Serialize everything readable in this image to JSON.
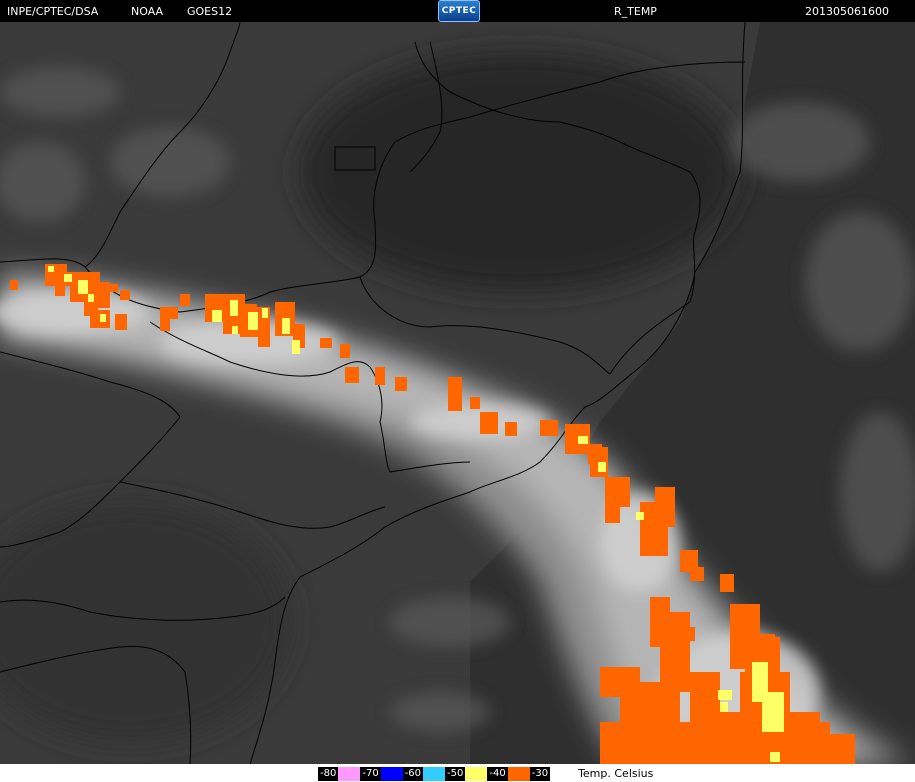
{
  "header": {
    "source": "INPE/CPTEC/DSA",
    "agency": "NOAA",
    "satellite": "GOES12",
    "logo_text": "CPTEC",
    "product": "R_TEMP",
    "timestamp": "201305061600"
  },
  "colors": {
    "background": "#000000",
    "cloud_base": "#c8c8c8",
    "land_dark": "#3a3a3a",
    "ocean_dark": "#2c2c2c",
    "border_lines": "#000000",
    "band_minus30": "#ff6600",
    "band_minus40": "#ffff66"
  },
  "legend": {
    "caption": "Temp. Celsius",
    "items": [
      {
        "label": "-80",
        "color": "#ff99ff"
      },
      {
        "label": "-70",
        "color": "#0000ff"
      },
      {
        "label": "-60",
        "color": "#33ccff"
      },
      {
        "label": "-50",
        "color": "#ffff66"
      },
      {
        "label": "-40",
        "color": "#ff6600"
      },
      {
        "label": "-30",
        "color": "#ffffff"
      }
    ]
  }
}
